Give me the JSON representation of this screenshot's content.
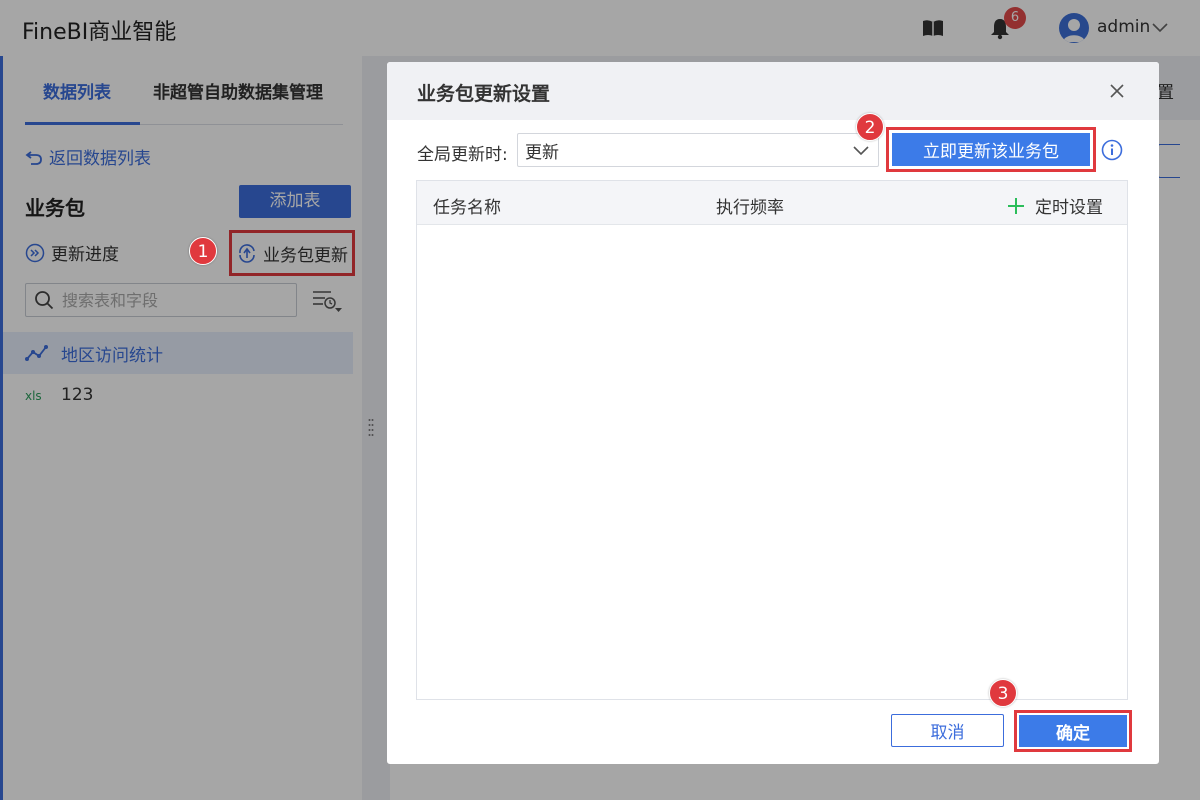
{
  "header": {
    "app_title": "FineBI商业智能",
    "notification_count": "6",
    "user_name": "admin"
  },
  "left_panel": {
    "tabs": [
      {
        "label": "数据列表"
      },
      {
        "label": "非超管自助数据集管理"
      }
    ],
    "back_link": "返回数据列表",
    "package_title": "业务包",
    "add_table_label": "添加表",
    "update_progress_label": "更新进度",
    "package_update_label": "业务包更新",
    "search_placeholder": "搜索表和字段",
    "tree_items": [
      {
        "label": "地区访问统计",
        "icon": "line-chart-icon"
      },
      {
        "label": "123",
        "icon": "xls-icon"
      }
    ]
  },
  "background": {
    "partial_text": "置"
  },
  "dialog": {
    "title": "业务包更新设置",
    "global_update_label": "全局更新时:",
    "global_update_value": "更新",
    "update_now_label": "立即更新该业务包",
    "table_headers": {
      "task_name": "任务名称",
      "frequency": "执行频率",
      "schedule": "定时设置"
    },
    "cancel_label": "取消",
    "confirm_label": "确定"
  },
  "annotations": [
    {
      "label": "1"
    },
    {
      "label": "2"
    },
    {
      "label": "3"
    }
  ],
  "colors": {
    "accent": "#3c6ddc",
    "highlight": "#e0393e",
    "add_green": "#2bbd5a"
  }
}
